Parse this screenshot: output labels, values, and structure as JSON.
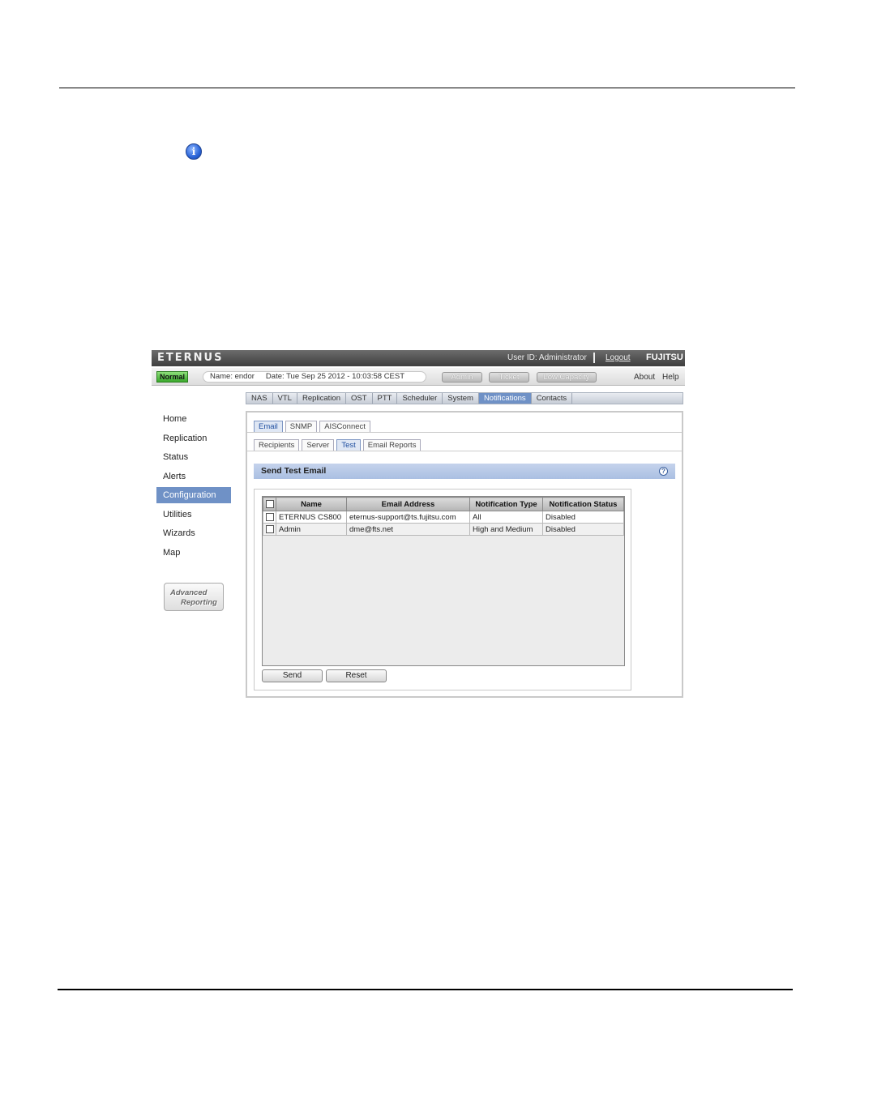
{
  "app": {
    "brand": "ETERNUS",
    "user_id": "User ID: Administrator",
    "logout": "Logout",
    "vendor": "FUJITSU"
  },
  "status": {
    "badge": "Normal",
    "name": "Name: endor",
    "date": "Date: Tue Sep 25 2012 - 10:03:58 CEST",
    "buttons": [
      "Admin",
      "Ticket",
      "Low Capacity"
    ],
    "about": "About",
    "help": "Help"
  },
  "topnav": [
    "NAS",
    "VTL",
    "Replication",
    "OST",
    "PTT",
    "Scheduler",
    "System",
    "Notifications",
    "Contacts"
  ],
  "topnav_active": "Notifications",
  "sidenav": [
    "Home",
    "Replication",
    "Status",
    "Alerts",
    "Configuration",
    "Utilities",
    "Wizards",
    "Map"
  ],
  "sidenav_active": "Configuration",
  "advanced": {
    "line1": "Advanced",
    "line2": "Reporting"
  },
  "tabs1": [
    "Email",
    "SNMP",
    "AISConnect"
  ],
  "tabs1_active": "Email",
  "tabs2": [
    "Recipients",
    "Server",
    "Test",
    "Email Reports"
  ],
  "tabs2_active": "Test",
  "section_title": "Send Test Email",
  "help_glyph": "?",
  "table": {
    "headers": [
      "Name",
      "Email Address",
      "Notification Type",
      "Notification Status"
    ],
    "rows": [
      [
        "ETERNUS CS800",
        "eternus-support@ts.fujitsu.com",
        "All",
        "Disabled"
      ],
      [
        "Admin",
        "dme@fts.net",
        "High and Medium",
        "Disabled"
      ]
    ]
  },
  "actions": {
    "send": "Send",
    "reset": "Reset"
  },
  "info_glyph": "i"
}
